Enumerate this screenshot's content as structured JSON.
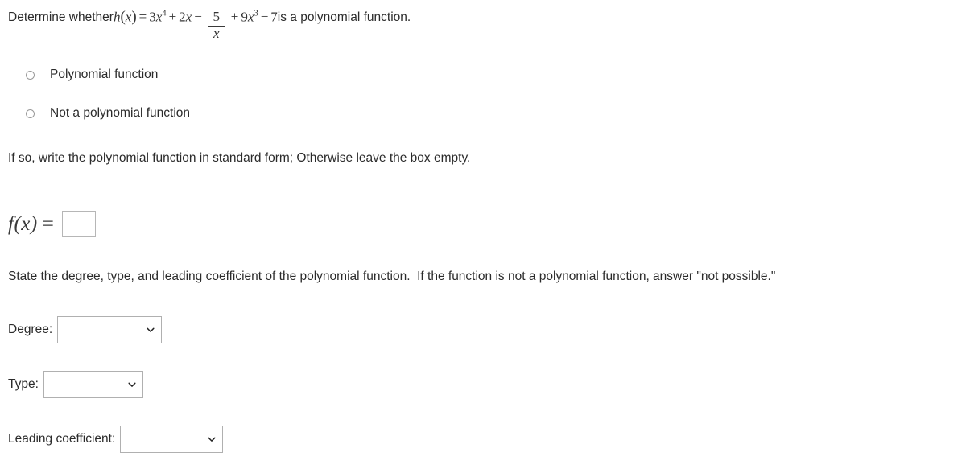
{
  "question": {
    "lead_text": "Determine whether ",
    "function_name": "h",
    "open_paren": "(",
    "variable": "x",
    "close_paren": ")",
    "equals": "=",
    "term1_coef": "3",
    "term1_var": "x",
    "term1_exp": "4",
    "op1": "+",
    "term2_coef": "2",
    "term2_var": "x",
    "op2": "−",
    "fraction_numerator": "5",
    "fraction_denominator": "x",
    "op3": "+",
    "term4_coef": "9",
    "term4_var": "x",
    "term4_exp": "3",
    "op4": "−",
    "term5": "7",
    "trail_text": " is a polynomial function."
  },
  "options": [
    {
      "label": "Polynomial function",
      "selected": false
    },
    {
      "label": "Not a polynomial function",
      "selected": false
    }
  ],
  "instructions": {
    "standard_form": "If so, write the polynomial function in standard form; Otherwise leave the box empty.",
    "state_properties": "State the degree, type, and leading coefficient of the polynomial function.  If the function is not a polynomial function, answer \"not possible.\""
  },
  "answer": {
    "fx_label_f": "f",
    "fx_label_open": "(",
    "fx_label_var": "x",
    "fx_label_close": ")",
    "fx_label_equals": "=",
    "value": "",
    "placeholder": ""
  },
  "fields": {
    "degree": {
      "label": "Degree:",
      "value": "",
      "icon": "chevron-down-icon"
    },
    "type": {
      "label": "Type:",
      "value": "",
      "icon": "chevron-down-icon"
    },
    "leading_coefficient": {
      "label": "Leading coefficient:",
      "value": "",
      "icon": "chevron-down-icon"
    }
  },
  "colors": {
    "background": "#ffffff",
    "text": "#2b2b2b",
    "math_text": "#333333",
    "field_border": "#b0b0b0",
    "answer_box_border": "#b6b6b6",
    "radio_border": "#9a9a9a"
  }
}
